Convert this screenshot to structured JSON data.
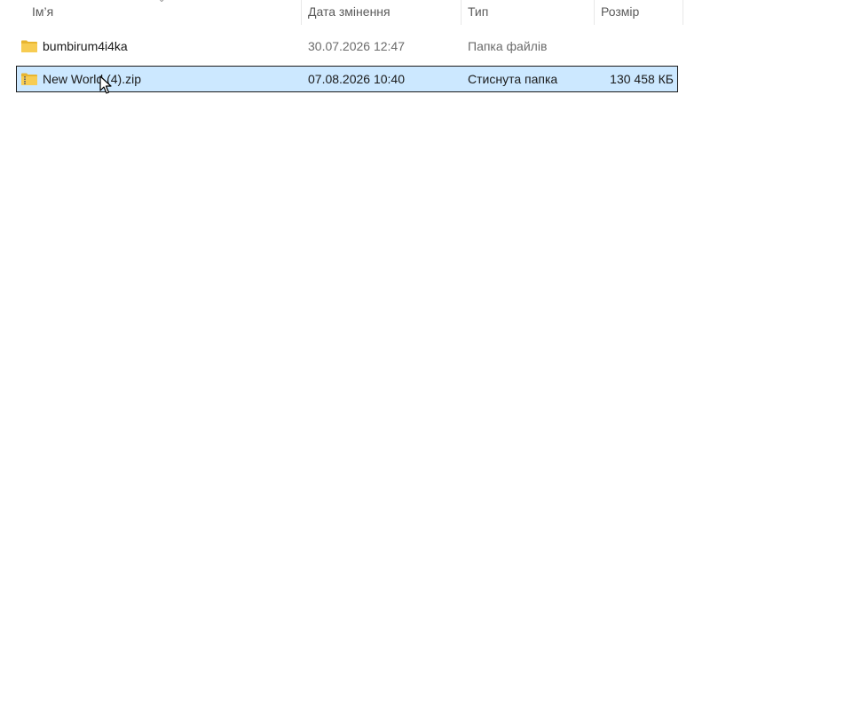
{
  "columns": {
    "name": "Ім’я",
    "date": "Дата змінення",
    "type": "Тип",
    "size": "Розмір"
  },
  "files": [
    {
      "name": "bumbirum4i4ka",
      "date": "30.07.2026 12:47",
      "type": "Папка файлів",
      "size": "",
      "icon": "folder-icon",
      "selected": false
    },
    {
      "name": "New World (4).zip",
      "date": "07.08.2026 10:40",
      "type": "Стиснута папка",
      "size": "130 458 КБ",
      "icon": "zip-folder-icon",
      "selected": true
    }
  ],
  "colors": {
    "selection_bg": "#cce8ff",
    "folder": "#f5c542"
  }
}
